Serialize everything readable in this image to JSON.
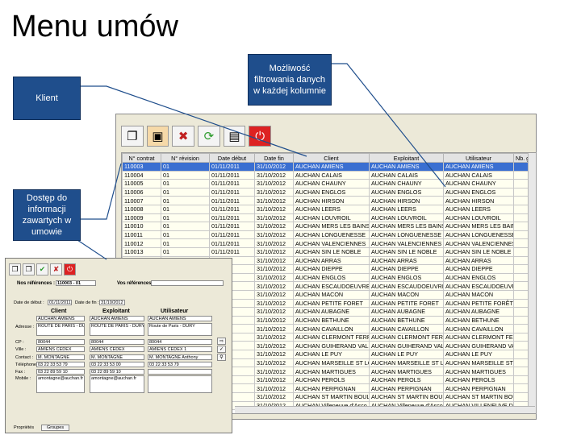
{
  "title": "Menu umów",
  "callouts": {
    "filter": "Możliwość filtrowania danych w każdej kolumnie",
    "client": "Klient",
    "access": "Dostęp do informacji zawartych w umowie"
  },
  "toolbar_icons": [
    "copy-icon",
    "edit-icon",
    "delete-icon",
    "refresh-icon",
    "print-icon",
    "exit-icon"
  ],
  "table": {
    "headers": [
      "N° contrat",
      "N° révision",
      "Date début",
      "Date fin",
      "Client",
      "Exploitant",
      "Utilisateur",
      "Nb. g"
    ],
    "rows": [
      [
        "110003",
        "01",
        "01/11/2011",
        "31/10/2012",
        "AUCHAN AMIENS",
        "AUCHAN AMIENS",
        "AUCHAN AMIENS",
        ""
      ],
      [
        "110004",
        "01",
        "01/11/2011",
        "31/10/2012",
        "AUCHAN CALAIS",
        "AUCHAN CALAIS",
        "AUCHAN CALAIS",
        ""
      ],
      [
        "110005",
        "01",
        "01/11/2011",
        "31/10/2012",
        "AUCHAN CHAUNY",
        "AUCHAN CHAUNY",
        "AUCHAN CHAUNY",
        ""
      ],
      [
        "110006",
        "01",
        "01/11/2011",
        "31/10/2012",
        "AUCHAN ENGLOS",
        "AUCHAN ENGLOS",
        "AUCHAN ENGLOS",
        ""
      ],
      [
        "110007",
        "01",
        "01/11/2011",
        "31/10/2012",
        "AUCHAN HIRSON",
        "AUCHAN HIRSON",
        "AUCHAN HIRSON",
        ""
      ],
      [
        "110008",
        "01",
        "01/11/2011",
        "31/10/2012",
        "AUCHAN LEERS",
        "AUCHAN LEERS",
        "AUCHAN LEERS",
        ""
      ],
      [
        "110009",
        "01",
        "01/11/2011",
        "31/10/2012",
        "AUCHAN LOUVROIL",
        "AUCHAN LOUVROIL",
        "AUCHAN LOUVROIL",
        ""
      ],
      [
        "110010",
        "01",
        "01/11/2011",
        "31/10/2012",
        "AUCHAN MERS LES BAINS",
        "AUCHAN MERS LES BAINS",
        "AUCHAN MERS LES BAINS",
        ""
      ],
      [
        "110011",
        "01",
        "01/11/2011",
        "31/10/2012",
        "AUCHAN LONGUENESSE",
        "AUCHAN LONGUENESSE",
        "AUCHAN LONGUENESSE",
        ""
      ],
      [
        "110012",
        "01",
        "01/11/2011",
        "31/10/2012",
        "AUCHAN VALENCIENNES",
        "AUCHAN VALENCIENNES",
        "AUCHAN VALENCIENNES",
        ""
      ],
      [
        "110013",
        "01",
        "01/11/2011",
        "31/10/2012",
        "AUCHAN SIN LE NOBLE",
        "AUCHAN SIN LE NOBLE",
        "AUCHAN SIN LE NOBLE",
        ""
      ],
      [
        "",
        "",
        "11",
        "31/10/2012",
        "AUCHAN ARRAS",
        "AUCHAN ARRAS",
        "AUCHAN ARRAS",
        ""
      ],
      [
        "",
        "",
        "11",
        "31/10/2012",
        "AUCHAN DIEPPE",
        "AUCHAN DIEPPE",
        "AUCHAN DIEPPE",
        ""
      ],
      [
        "",
        "",
        "11",
        "31/10/2012",
        "AUCHAN ENGLOS",
        "AUCHAN ENGLOS",
        "AUCHAN ENGLOS",
        ""
      ],
      [
        "",
        "",
        "11",
        "31/10/2012",
        "AUCHAN ESCAUDOEUVRES",
        "AUCHAN ESCAUDOEUVRES",
        "AUCHAN ESCAUDOEUVRES",
        ""
      ],
      [
        "",
        "",
        "11",
        "31/10/2012",
        "AUCHAN MACON",
        "AUCHAN MACON",
        "AUCHAN MACON",
        ""
      ],
      [
        "",
        "",
        "11",
        "31/10/2012",
        "AUCHAN PETITE FORET",
        "AUCHAN PETITE FORET",
        "AUCHAN PETITE FORÊT",
        ""
      ],
      [
        "",
        "",
        "11",
        "31/10/2012",
        "AUCHAN AUBAGNE",
        "AUCHAN AUBAGNE",
        "AUCHAN AUBAGNE",
        ""
      ],
      [
        "",
        "",
        "11",
        "31/10/2012",
        "AUCHAN BETHUNE",
        "AUCHAN BETHUNE",
        "AUCHAN BETHUNE",
        ""
      ],
      [
        "",
        "",
        "11",
        "31/10/2012",
        "AUCHAN CAVAILLON",
        "AUCHAN CAVAILLON",
        "AUCHAN CAVAILLON",
        ""
      ],
      [
        "",
        "",
        "11",
        "31/10/2012",
        "AUCHAN CLERMONT FERRAND",
        "AUCHAN CLERMONT FERRAND",
        "AUCHAN CLERMONT FERRAN",
        ""
      ],
      [
        "",
        "",
        "11",
        "31/10/2012",
        "AUCHAN GUIHERAND VALENCE",
        "AUCHAN GUIHERAND VALENCE",
        "AUCHAN GUIHERAND VALENC",
        ""
      ],
      [
        "",
        "",
        "11",
        "31/10/2012",
        "AUCHAN LE PUY",
        "AUCHAN LE PUY",
        "AUCHAN LE PUY",
        ""
      ],
      [
        "",
        "",
        "11",
        "31/10/2012",
        "AUCHAN MARSEILLE ST LOUP",
        "AUCHAN MARSEILLE ST LOUP",
        "AUCHAN MARSEILLE ST LOUP",
        ""
      ],
      [
        "",
        "",
        "11",
        "31/10/2012",
        "AUCHAN MARTIGUES",
        "AUCHAN MARTIGUES",
        "AUCHAN MARTIGUES",
        ""
      ],
      [
        "",
        "",
        "11",
        "31/10/2012",
        "AUCHAN PEROLS",
        "AUCHAN PEROLS",
        "AUCHAN PEROLS",
        ""
      ],
      [
        "",
        "",
        "11",
        "31/10/2012",
        "AUCHAN PERPIGNAN",
        "AUCHAN PERPIGNAN",
        "AUCHAN PERPIGNAN",
        ""
      ],
      [
        "",
        "",
        "11",
        "31/10/2012",
        "AUCHAN ST MARTIN BOULOGNE",
        "AUCHAN ST MARTIN BOULOGNE",
        "AUCHAN ST MARTIN BOULOG",
        ""
      ],
      [
        "",
        "",
        "11",
        "31/10/2012",
        "AUCHAN Villeneuve d'Asco",
        "AUCHAN Villeneuve d'Asco",
        "AUCHAN VILLENEUVE D'ASCQ",
        ""
      ]
    ]
  },
  "detail": {
    "refs_label": "Nos références :",
    "refs_value": "110003 - 01",
    "vos_refs_label": "Vos références :",
    "date_debut_label": "Date de début :",
    "date_debut": "01/11/2011",
    "date_fin_label": "Date de fin :",
    "date_fin": "31/10/2012",
    "col_client": "Client",
    "col_exploitant": "Exploitant",
    "col_utilisateur": "Utilisateur",
    "adresse_label": "Adresse :",
    "cp_label": "CP :",
    "ville_label": "Ville :",
    "contact_label": "Contact :",
    "telephone_label": "Téléphone :",
    "fax_label": "Fax :",
    "mobile_label": "Mobile :",
    "client": {
      "name": "AUCHAN AMIENS",
      "adresse": "ROUTE DE PARIS - DURY",
      "cp": "80044",
      "ville": "AMIENS CEDEX",
      "contact": "M. MONTAGNE",
      "tel": "03 22 33 53 79",
      "fax": "03 22 89 59 10",
      "mail": "amontagne@auchan.fr"
    },
    "exploitant": {
      "name": "AUCHAN AMIENS",
      "adresse": "ROUTE DE PARIS - DURY",
      "cp": "80044",
      "ville": "AMIENS CEDEX",
      "contact": "M. MONTAGNE",
      "tel": "03 22 33 53 00",
      "fax": "03 22 89 59 10",
      "mail": "amontagne@auchan.fr"
    },
    "utilisateur": {
      "name": "AUCHAN AMIENS",
      "adresse": "Route de Paris - DURY",
      "cp": "80044",
      "ville": "AMIENS CEDEX 1",
      "contact": "M. MONTAGNE Anthony",
      "tel": "03 22 33 53 79"
    },
    "tab_proprietes": "Propriétés",
    "tab_groupes": "Groupes"
  }
}
